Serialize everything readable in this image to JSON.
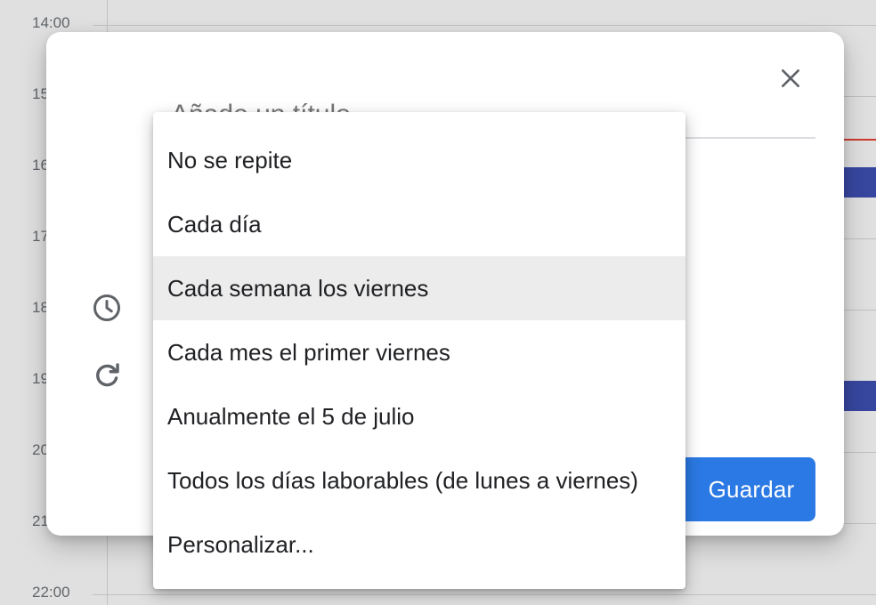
{
  "calendar": {
    "time_labels": [
      "14:00",
      "15",
      "16",
      "17",
      "18",
      "19",
      "20",
      "21",
      "22:00"
    ]
  },
  "dialog": {
    "title_placeholder": "Añade un título",
    "save_label": "Guardar",
    "close_icon": "close-icon",
    "clock_icon": "clock-icon",
    "repeat_icon": "repeat-icon"
  },
  "recurrence_menu": {
    "items": [
      {
        "label": "No se repite"
      },
      {
        "label": "Cada día"
      },
      {
        "label": "Cada semana los viernes"
      },
      {
        "label": "Cada mes el primer viernes"
      },
      {
        "label": "Anualmente el 5 de julio"
      },
      {
        "label": "Todos los días laborables (de lunes a viernes)"
      },
      {
        "label": "Personalizar..."
      }
    ],
    "highlighted_label": "Cada semana los viernes"
  },
  "colors": {
    "save_button": "#2b79e4",
    "event": "#3f51b5",
    "current_time": "#ea4335"
  }
}
